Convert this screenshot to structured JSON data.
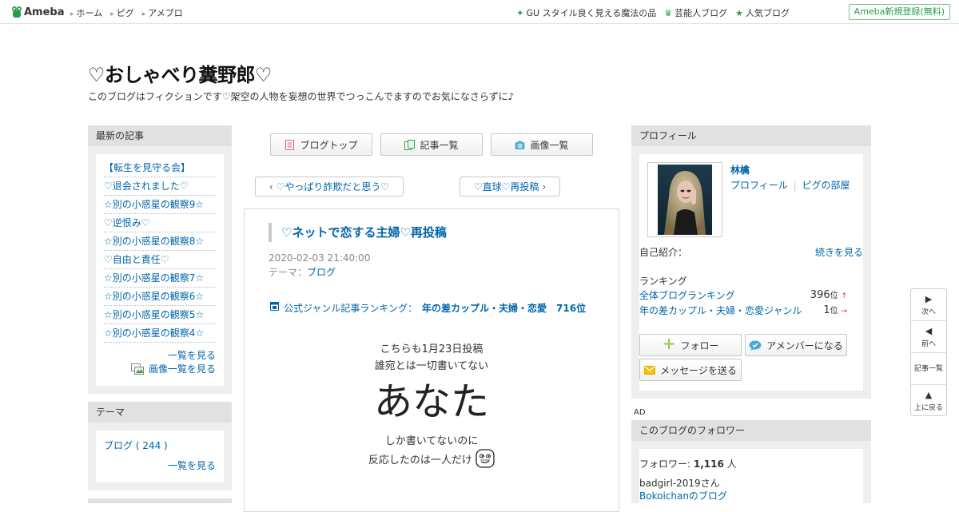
{
  "topbar": {
    "logo": "Ameba",
    "nav": [
      "ホーム",
      "ピグ",
      "アメブロ"
    ],
    "right_links": [
      {
        "icon": "sparkle-icon",
        "label": "GU スタイル良く見える魔法の品"
      },
      {
        "icon": "crown-icon",
        "label": "芸能人ブログ"
      },
      {
        "icon": "star-icon",
        "label": "人気ブログ"
      }
    ],
    "signup": "Ameba新規登録(無料)"
  },
  "blog": {
    "title": "♡おしゃべり糞野郎♡",
    "description": "このブログはフィクションです♡架空の人物を妄想の世界でつっこんでますのでお気になさらずに♪"
  },
  "latest": {
    "header": "最新の記事",
    "items": [
      "【転生を見守る会】",
      "♡退会されました♡",
      "☆別の小惑星の観察9☆",
      "♡逆恨み♡",
      "☆別の小惑星の観察8☆",
      "♡自由と責任♡",
      "☆別の小惑星の観察7☆",
      "☆別の小惑星の観察6☆",
      "☆別の小惑星の観察5☆",
      "☆別の小惑星の観察4☆"
    ],
    "more": "一覧を見る",
    "images": "画像一覧を見る"
  },
  "theme": {
    "header": "テーマ",
    "item": "ブログ ( 244 )",
    "more": "一覧を見る"
  },
  "main": {
    "tabs": [
      "ブログトップ",
      "記事一覧",
      "画像一覧"
    ],
    "prev": "♡やっぱり詐欺だと思う♡",
    "next": "♡直球♡再投稿",
    "article": {
      "title": "♡ネットで恋する主婦♡再投稿",
      "date": "2020-02-03 21:40:00",
      "theme_label": "テーマ：",
      "theme": "ブログ",
      "ranking_label": "公式ジャンル記事ランキング：",
      "ranking_value": "年の差カップル・夫婦・恋愛　716位",
      "body_line1": "こちらも1月23日投稿",
      "body_line2": "誰宛とは一切書いてない",
      "body_big": "あなた",
      "body_line3": "しか書いてないのに",
      "body_line4": "反応したのは一人だけ"
    }
  },
  "profile": {
    "header": "プロフィール",
    "name": "林檎",
    "profile_link": "プロフィール",
    "pigg_link": "ピグの部屋",
    "intro_label": "自己紹介：",
    "intro_more": "続きを見る",
    "ranking_header": "ランキング",
    "rank1_label": "全体ブログランキング",
    "rank1_value": "396",
    "rank2_label": "年の差カップル・夫婦・恋愛ジャンル",
    "rank2_value": "1",
    "rank_unit": "位",
    "follow": "フォロー",
    "member": "アメンバーになる",
    "message": "メッセージを送る"
  },
  "ad_label": "AD",
  "followers": {
    "header": "このブログのフォロワー",
    "label": "フォロワー:",
    "count": "1,116",
    "unit": "人",
    "follower1": "badgirl-2019さん",
    "follower2": "Bokoichanのブログ"
  },
  "floatnav": {
    "next": "次へ",
    "prev": "前へ",
    "list": "記事一覧",
    "top": "上に戻る"
  },
  "colors": {
    "link": "#0066aa",
    "green": "#2a9d4a",
    "up": "#e03030",
    "box_bg": "#eeeeee"
  }
}
